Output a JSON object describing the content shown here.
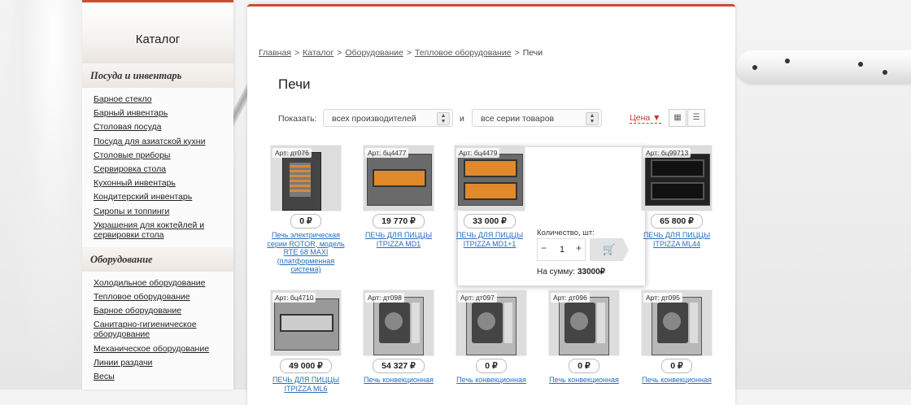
{
  "sidebar": {
    "catalog_title": "Каталог",
    "section1_title": "Посуда и инвентарь",
    "section1_items": [
      "Барное стекло",
      "Барный инвентарь",
      "Столовая посуда",
      "Посуда для азиатской кухни",
      "Столовые приборы",
      "Сервировка стола",
      "Кухонный инвентарь",
      "Кондитерский инвентарь",
      "Сиропы и топпинги",
      "Украшения для коктейлей и сервировки стола"
    ],
    "section2_title": "Оборудование",
    "section2_items": [
      "Холодильное оборудование",
      "Тепловое оборудование",
      "Барное оборудование",
      "Санитарно-гигиеническое оборудование",
      "Механическое оборудование",
      "Линии раздачи",
      "Весы"
    ]
  },
  "breadcrumb": [
    "Главная",
    "Каталог",
    "Оборудование",
    "Тепловое оборудование",
    "Печи"
  ],
  "breadcrumb_sep": ">",
  "page_title": "Печи",
  "filters": {
    "show_label": "Показать:",
    "manufacturer_value": "всех производителей",
    "and_label": "и",
    "series_value": "все серии товаров",
    "sort_label": "Цена",
    "sort_arrow": "▼",
    "grid_icon": "grid-icon",
    "list_icon": "list-icon"
  },
  "products": [
    {
      "art": "Арт: дт076",
      "price": "0 ₽",
      "name": "Печь электрическая серии ROTOR, модель RTE 68 MAXI (платформенная система)"
    },
    {
      "art": "Арт: бц4477",
      "price": "19 770 ₽",
      "name": "ПЕЧЬ ДЛЯ ПИЦЦЫ ITPIZZA MD1"
    },
    {
      "art": "Арт: бц4479",
      "price": "33 000 ₽",
      "name": "ПЕЧЬ ДЛЯ ПИЦЦЫ ITPIZZA MD1+1"
    },
    {
      "art": "Арт: бц99713",
      "price": "65 800 ₽",
      "name": "ПЕЧЬ ДЛЯ ПИЦЦЫ ITPIZZA ML44"
    },
    {
      "art": "Арт: бц4710",
      "price": "49 000 ₽",
      "name": "ПЕЧЬ ДЛЯ ПИЦЦЫ ITPIZZA ML6"
    },
    {
      "art": "Арт: дт098",
      "price": "54 327 ₽",
      "name": "Печь конвекционная"
    },
    {
      "art": "Арт: дт097",
      "price": "0 ₽",
      "name": "Печь конвекционная"
    },
    {
      "art": "Арт: дт096",
      "price": "0 ₽",
      "name": "Печь конвекционная"
    },
    {
      "art": "Арт: дт095",
      "price": "0 ₽",
      "name": "Печь конвекционная"
    }
  ],
  "hover_card": {
    "qty_label": "Количество, шт:",
    "minus": "−",
    "qty_value": "1",
    "plus": "+",
    "cart_icon": "cart-icon",
    "sum_label": "На сумму:",
    "sum_value": "33000₽"
  },
  "colors": {
    "accent": "#c94d33",
    "link": "#2a6ebb",
    "sort": "#c0392b"
  }
}
